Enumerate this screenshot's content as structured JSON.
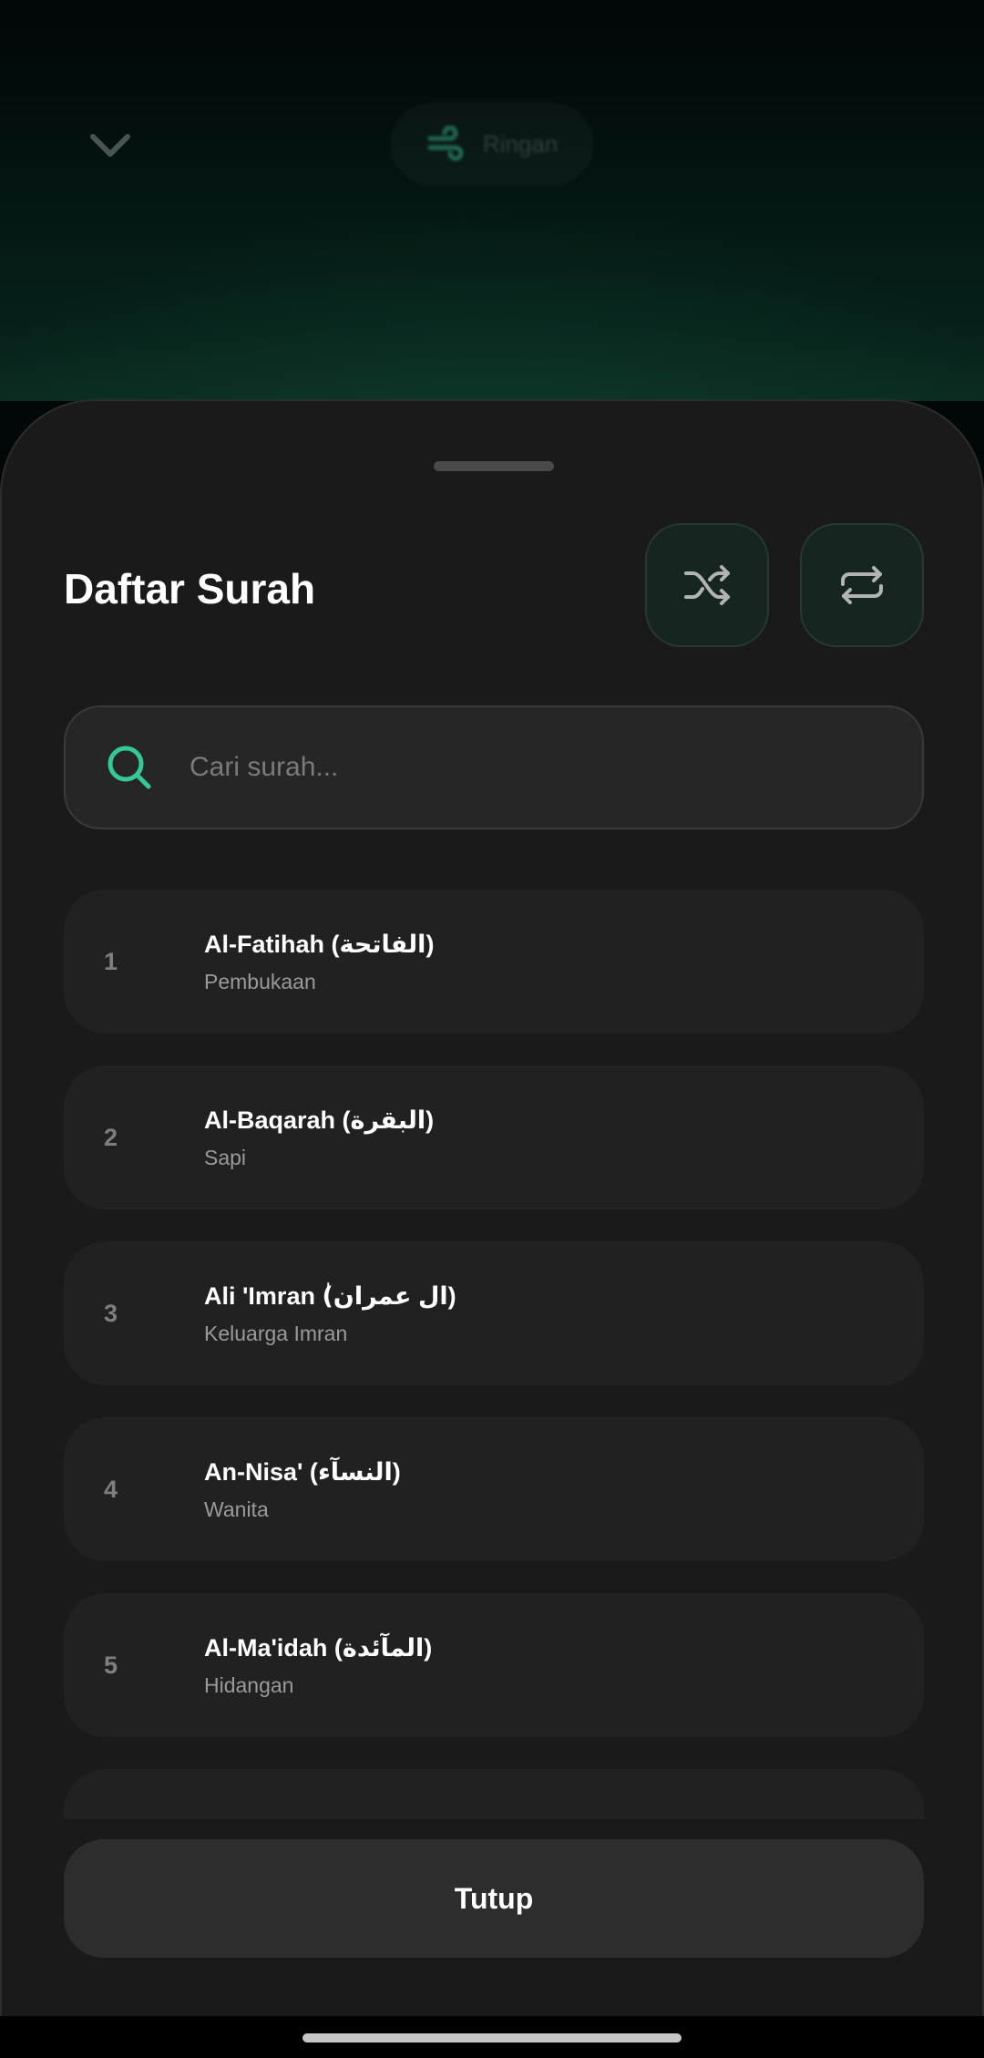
{
  "background": {
    "pill_label": "Ringan"
  },
  "sheet": {
    "title": "Daftar Surah",
    "shuffle_label": "shuffle-icon",
    "repeat_label": "repeat-icon"
  },
  "search": {
    "placeholder": "Cari surah...",
    "value": ""
  },
  "surahs": [
    {
      "number": "1",
      "name": "Al-Fatihah (الفاتحة)",
      "meaning": "Pembukaan"
    },
    {
      "number": "2",
      "name": "Al-Baqarah (البقرة)",
      "meaning": "Sapi"
    },
    {
      "number": "3",
      "name": "Ali 'Imran (ٰال عمران)",
      "meaning": "Keluarga Imran"
    },
    {
      "number": "4",
      "name": "An-Nisa' (النسآء)",
      "meaning": "Wanita"
    },
    {
      "number": "5",
      "name": "Al-Ma'idah (المآئدة)",
      "meaning": "Hidangan"
    }
  ],
  "close_button": "Tutup",
  "colors": {
    "accent": "#35c99a",
    "sheet_background": "#1a1a1a",
    "list_item_background": "#212121"
  }
}
